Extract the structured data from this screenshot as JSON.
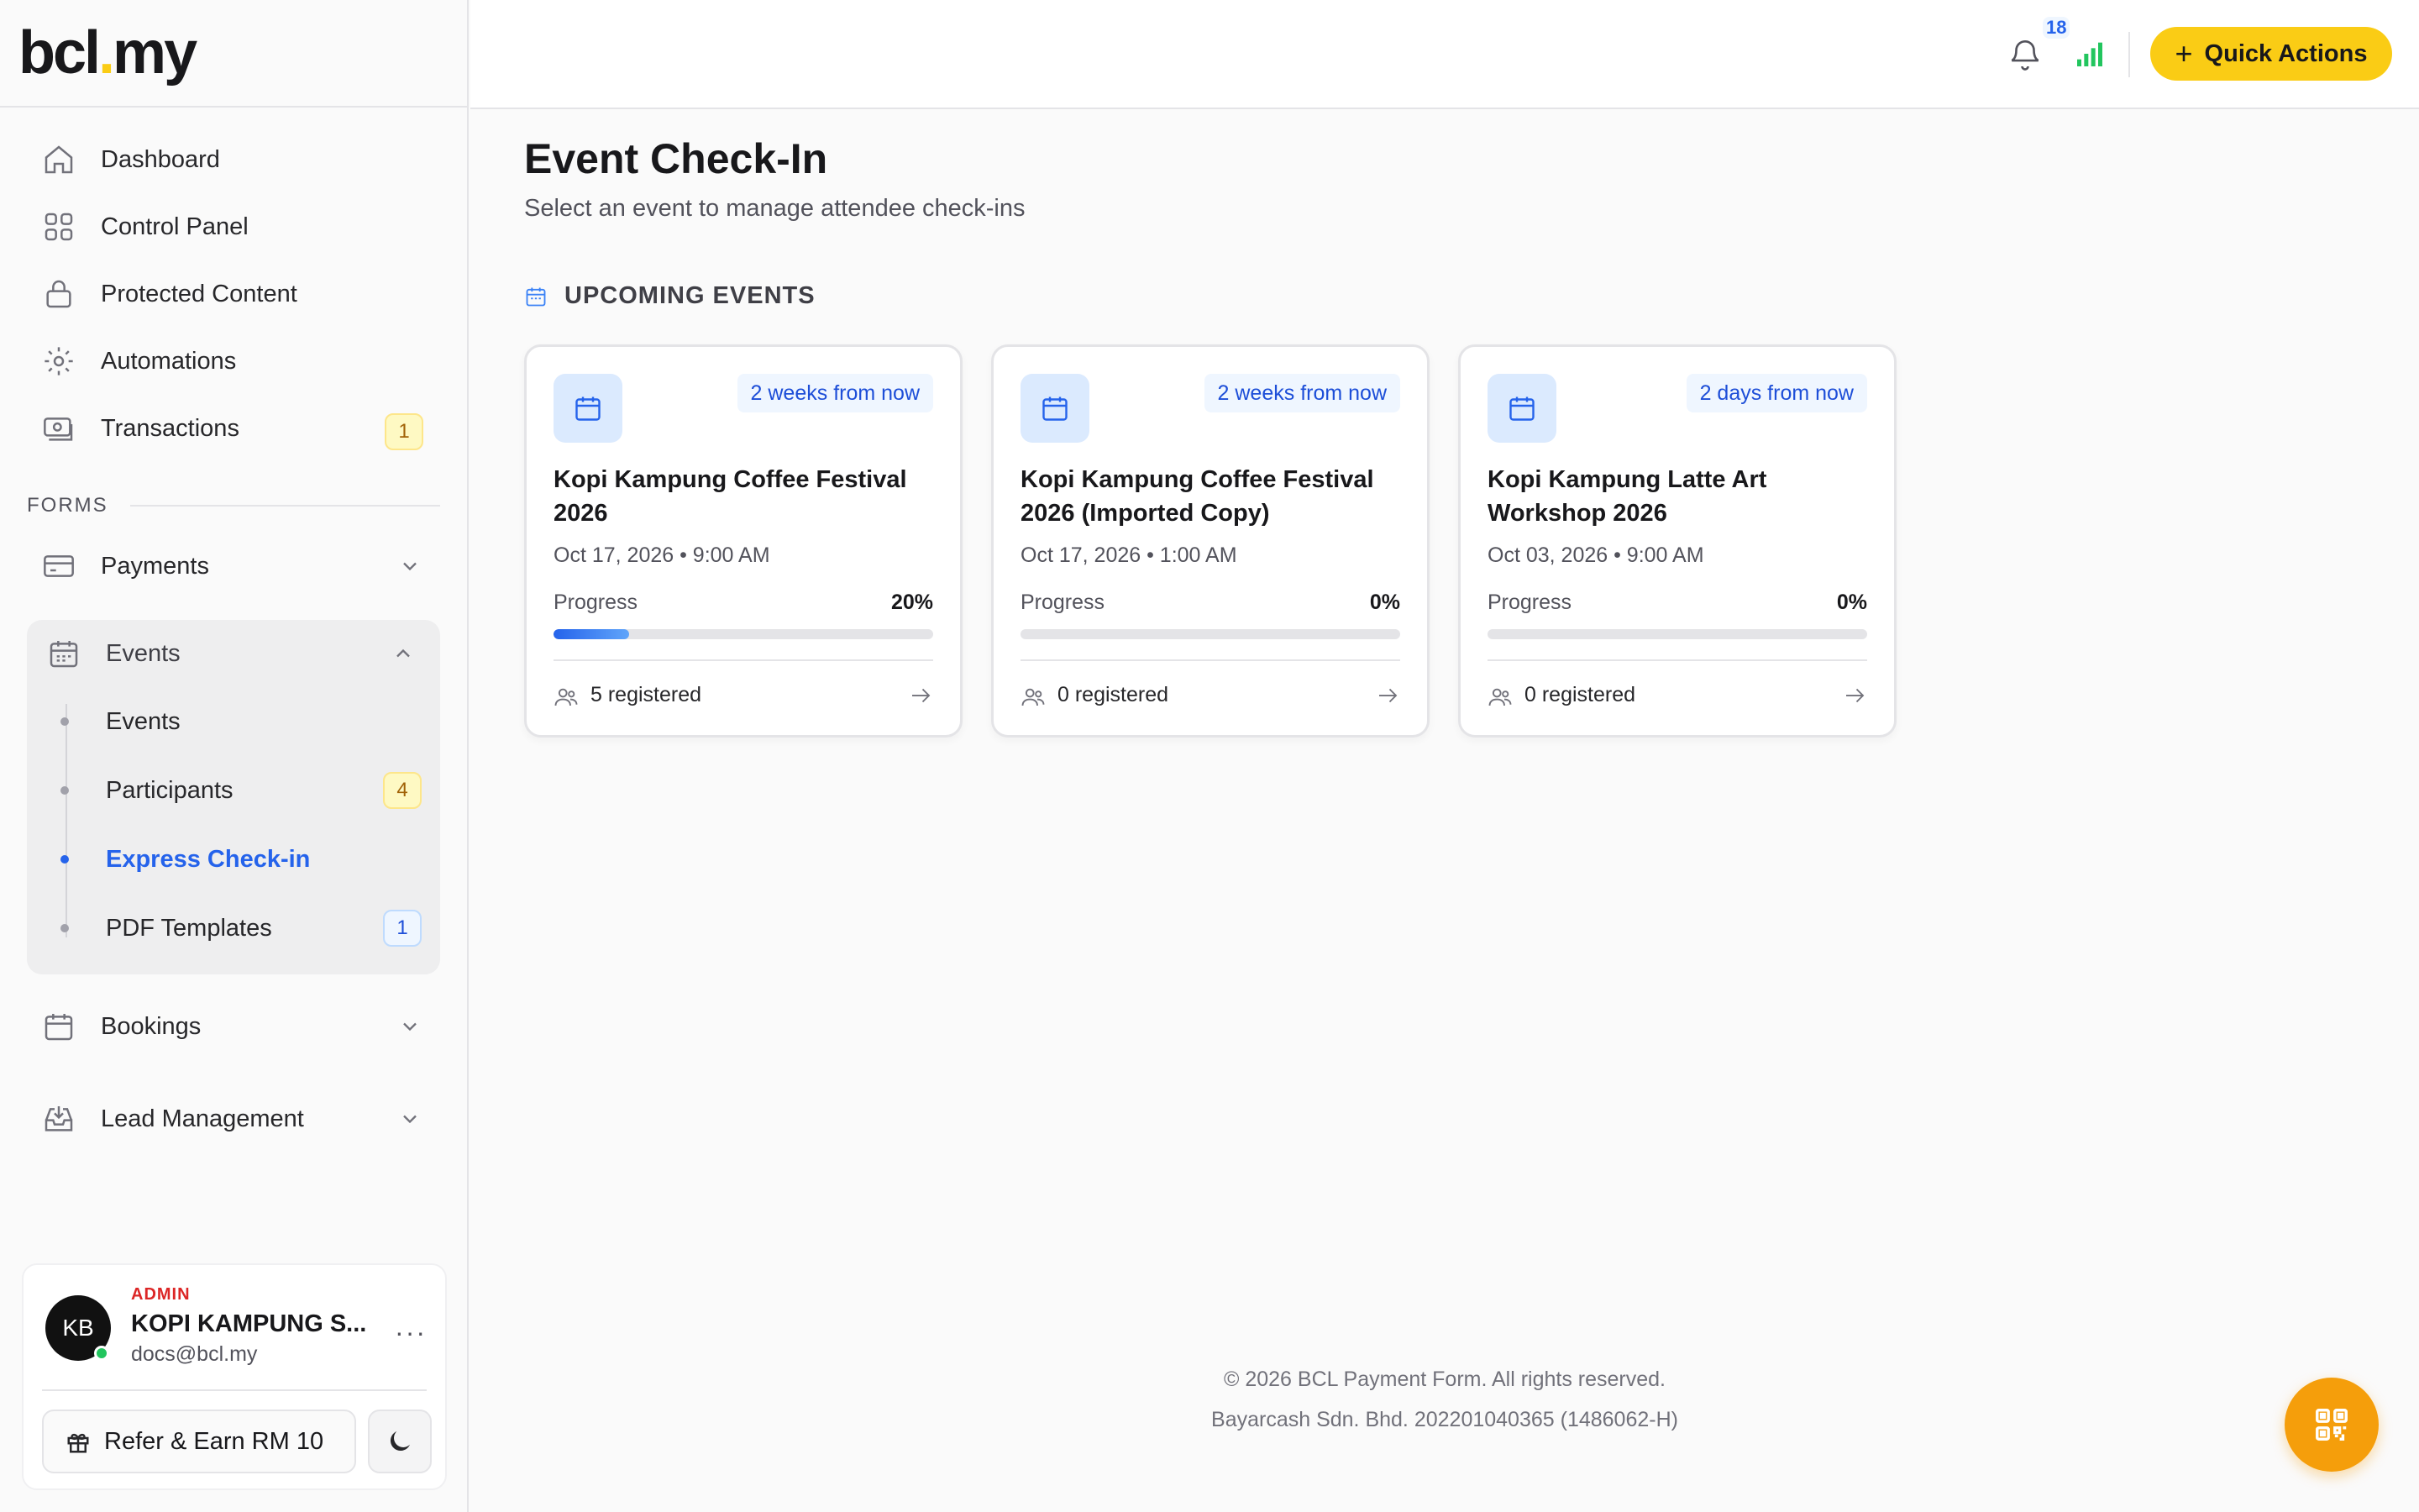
{
  "brand": {
    "logo_left": "bcl",
    "logo_dot": ".",
    "logo_right": "my"
  },
  "sidebar": {
    "items": [
      {
        "label": "Dashboard",
        "icon": "home-icon"
      },
      {
        "label": "Control Panel",
        "icon": "grid-icon"
      },
      {
        "label": "Protected Content",
        "icon": "lock-icon"
      },
      {
        "label": "Automations",
        "icon": "gear-icon"
      },
      {
        "label": "Transactions",
        "icon": "cash-icon",
        "badge": "1"
      }
    ],
    "forms_label": "FORMS",
    "payments": "Payments",
    "events_group": {
      "label": "Events",
      "sub": [
        {
          "label": "Events"
        },
        {
          "label": "Participants",
          "badge": "4"
        },
        {
          "label": "Express Check-in",
          "active": true
        },
        {
          "label": "PDF Templates",
          "badge": "1"
        }
      ]
    },
    "bookings": "Bookings",
    "lead_management": "Lead Management"
  },
  "user": {
    "initials": "KB",
    "role": "ADMIN",
    "name": "KOPI KAMPUNG S...",
    "email": "docs@bcl.my",
    "more": "···",
    "refer_label": "Refer & Earn RM 10"
  },
  "topbar": {
    "notification_count": "18",
    "quick_actions_label": "Quick Actions",
    "plus": "+"
  },
  "main": {
    "title": "Event Check-In",
    "subtitle": "Select an event to manage attendee check-ins",
    "section": "UPCOMING EVENTS",
    "events": [
      {
        "when": "2 weeks from now",
        "name": "Kopi Kampung Coffee Festival 2026",
        "date": "Oct 17, 2026 • 9:00 AM",
        "progress_label": "Progress",
        "progress_text": "20%",
        "progress": 0.2,
        "registered": "5 registered"
      },
      {
        "when": "2 weeks from now",
        "name": "Kopi Kampung Coffee Festival 2026 (Imported Copy)",
        "date": "Oct 17, 2026 • 1:00 AM",
        "progress_label": "Progress",
        "progress_text": "0%",
        "progress": 0,
        "registered": "0 registered"
      },
      {
        "when": "2 days from now",
        "name": "Kopi Kampung Latte Art Workshop 2026",
        "date": "Oct 03, 2026 • 9:00 AM",
        "progress_label": "Progress",
        "progress_text": "0%",
        "progress": 0,
        "registered": "0 registered"
      }
    ]
  },
  "footer": {
    "line1": "© 2026 BCL Payment Form. All rights reserved.",
    "line2": "Bayarcash Sdn. Bhd. 202201040365 (1486062-H)"
  },
  "colors": {
    "accent": "#2563eb",
    "brand_yellow": "#facc15",
    "fab_orange": "#f59e0b"
  }
}
